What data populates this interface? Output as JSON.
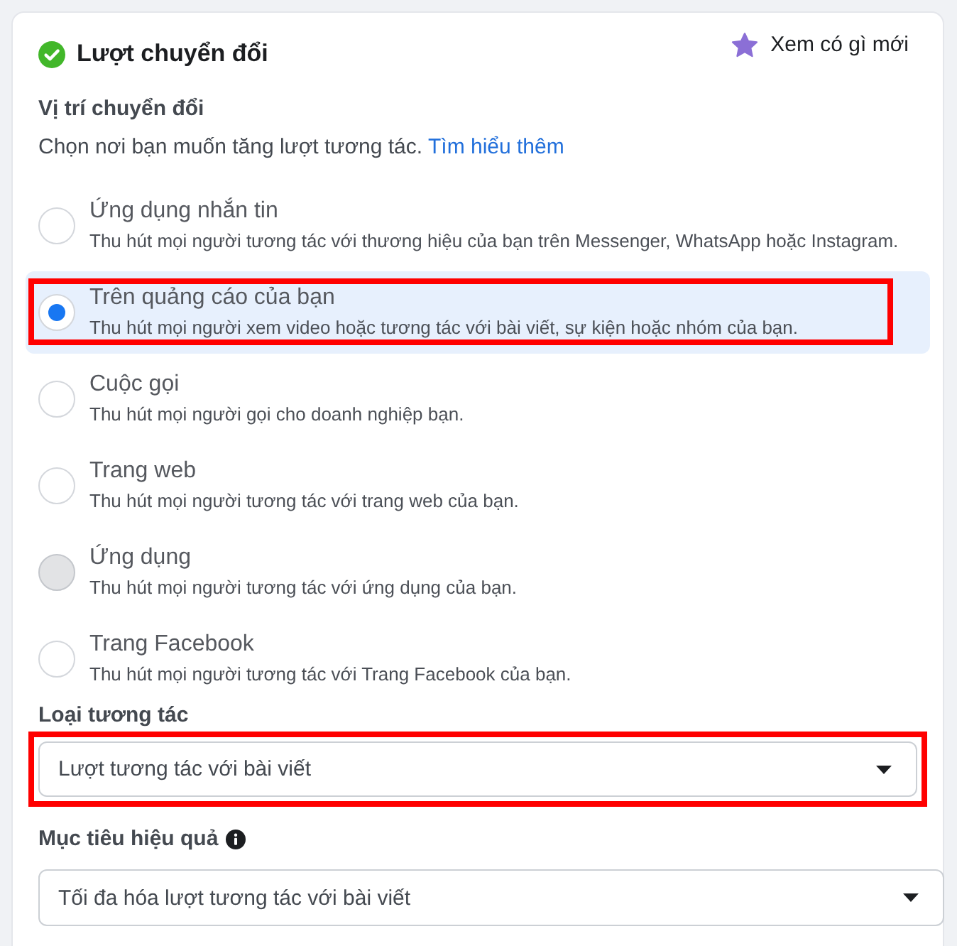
{
  "panel": {
    "title": "Lượt chuyển đổi",
    "completed": true,
    "whats_new": "Xem có gì mới"
  },
  "conversion_location": {
    "label": "Vị trí chuyển đổi",
    "description": "Chọn nơi bạn muốn tăng lượt tương tác.",
    "link": "Tìm hiểu thêm",
    "options": [
      {
        "title": "Ứng dụng nhắn tin",
        "description": "Thu hút mọi người tương tác với thương hiệu của bạn trên Messenger, WhatsApp hoặc Instagram.",
        "selected": false,
        "disabled": false,
        "annotated": false
      },
      {
        "title": "Trên quảng cáo của bạn",
        "description": "Thu hút mọi người xem video hoặc tương tác với bài viết, sự kiện hoặc nhóm của bạn.",
        "selected": true,
        "disabled": false,
        "annotated": true
      },
      {
        "title": "Cuộc gọi",
        "description": "Thu hút mọi người gọi cho doanh nghiệp bạn.",
        "selected": false,
        "disabled": false,
        "annotated": false
      },
      {
        "title": "Trang web",
        "description": "Thu hút mọi người tương tác với trang web của bạn.",
        "selected": false,
        "disabled": false,
        "annotated": false
      },
      {
        "title": "Ứng dụng",
        "description": "Thu hút mọi người tương tác với ứng dụng của bạn.",
        "selected": false,
        "disabled": true,
        "annotated": false
      },
      {
        "title": "Trang Facebook",
        "description": "Thu hút mọi người tương tác với Trang Facebook của bạn.",
        "selected": false,
        "disabled": false,
        "annotated": false
      }
    ]
  },
  "engagement_type": {
    "label": "Loại tương tác",
    "value": "Lượt tương tác với bài viết",
    "annotated": true
  },
  "performance_goal": {
    "label": "Mục tiêu hiệu quả",
    "value": "Tối đa hóa lượt tương tác với bài viết",
    "annotated": false
  }
}
